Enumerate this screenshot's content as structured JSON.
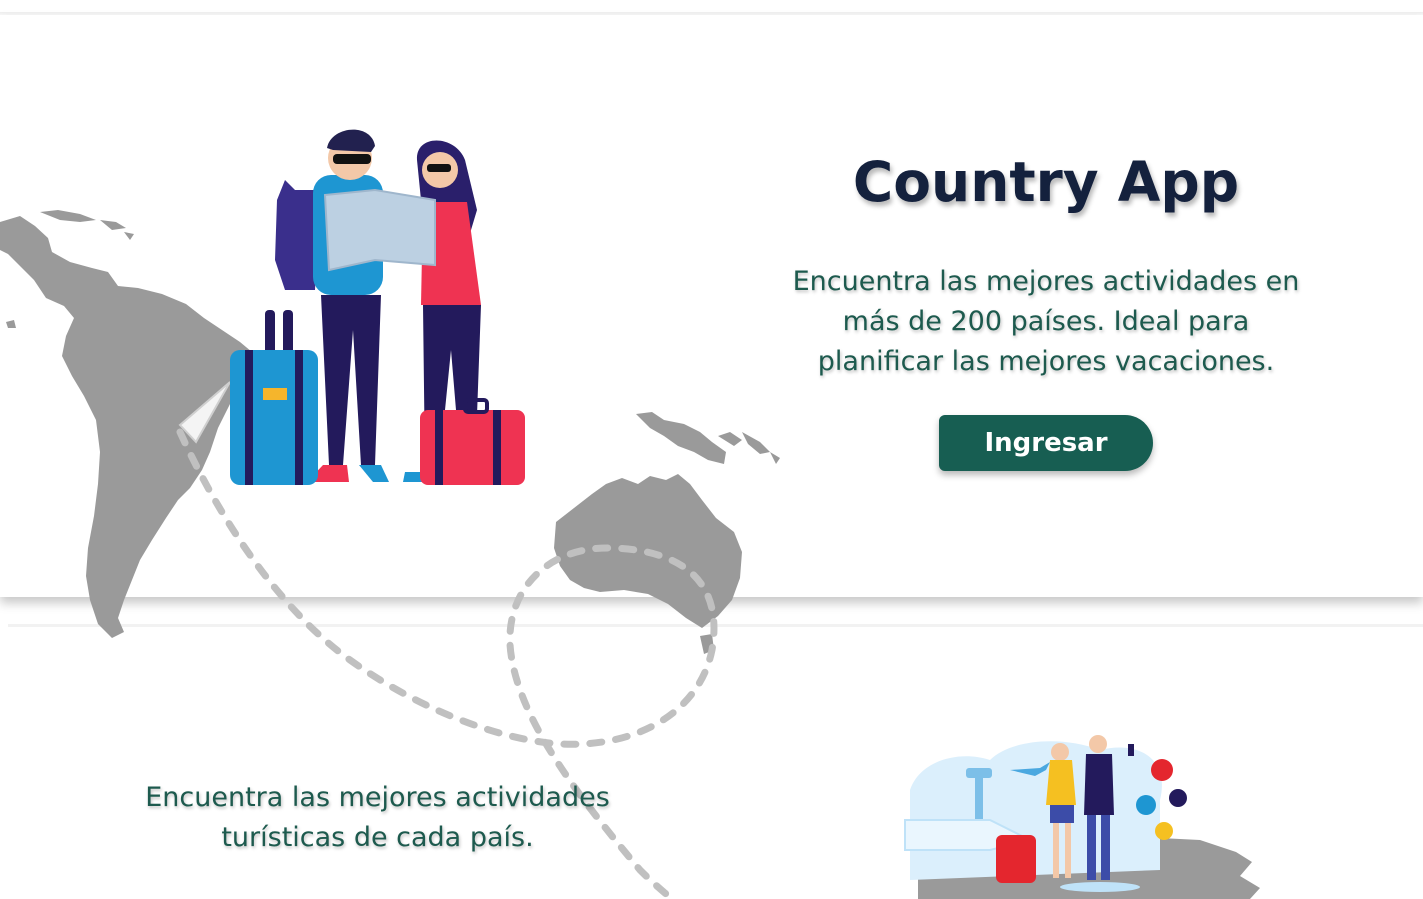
{
  "hero": {
    "title": "Country App",
    "subtitle": "Encuentra las mejores actividades en más de 200 países. Ideal para planificar las mejores vacaciones.",
    "cta_label": "Ingresar"
  },
  "feature": {
    "text": "Encuentra las mejores actividades turísticas de cada país."
  },
  "colors": {
    "title": "#14213d",
    "accent_text": "#1d5a4e",
    "button": "#175e52",
    "map": "#999999",
    "suitcase_blue": "#1e96d2",
    "suitcase_red": "#ef3352"
  },
  "icons": [
    "map-background",
    "travelers-illustration",
    "airport-travelers-illustration"
  ]
}
